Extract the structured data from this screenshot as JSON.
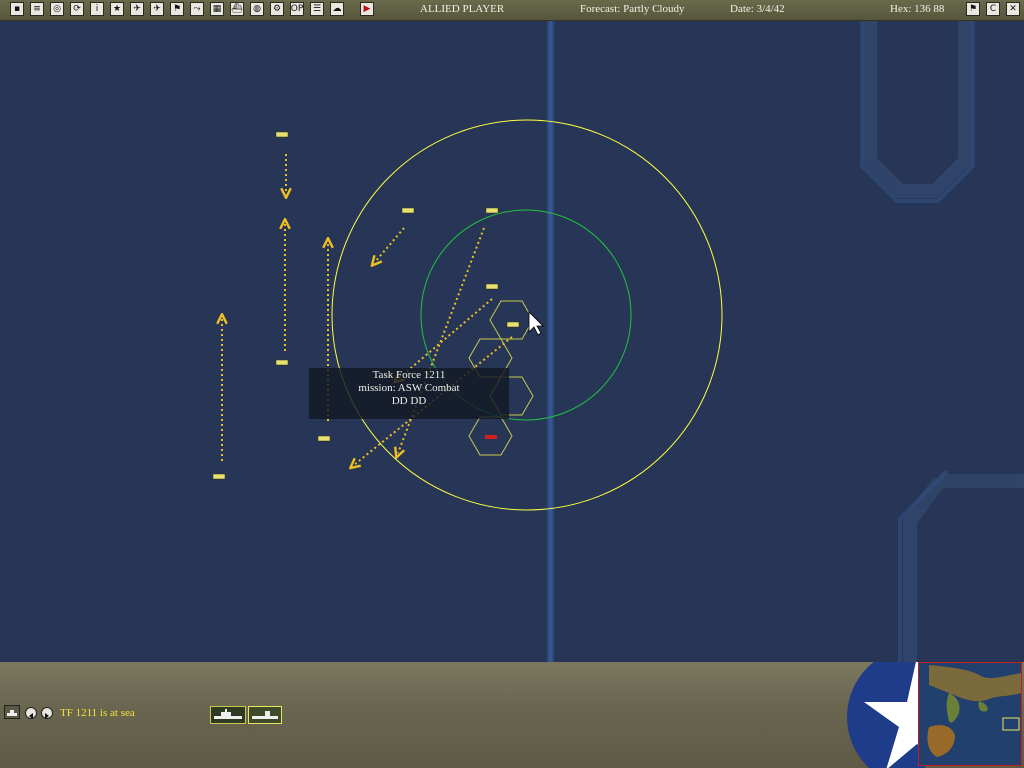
{
  "toolbar": {
    "icons": [
      {
        "name": "save-icon",
        "glyph": "▪"
      },
      {
        "name": "document-icon",
        "glyph": "≡"
      },
      {
        "name": "database-icon",
        "glyph": "◎"
      },
      {
        "name": "sync-icon",
        "glyph": "⟳"
      },
      {
        "name": "info-icon",
        "glyph": "i"
      },
      {
        "name": "medal-star-icon",
        "glyph": "★"
      },
      {
        "name": "aircraft-icon",
        "glyph": "✈"
      },
      {
        "name": "fighter-icon",
        "glyph": "✈"
      },
      {
        "name": "flag-icon",
        "glyph": "⚑"
      },
      {
        "name": "route-icon",
        "glyph": "⤳"
      },
      {
        "name": "intel-icon",
        "glyph": "▦"
      },
      {
        "name": "ship-icon",
        "glyph": "⛴"
      },
      {
        "name": "globe-icon",
        "glyph": "◍"
      },
      {
        "name": "settings-icon",
        "glyph": "⚙"
      },
      {
        "name": "op-icon",
        "glyph": "OP"
      },
      {
        "name": "list-icon",
        "glyph": "☰"
      },
      {
        "name": "weather-icon",
        "glyph": "☁"
      },
      {
        "name": "play-turn-icon",
        "glyph": "▶"
      }
    ],
    "player": "ALLIED PLAYER",
    "forecast": "Forecast: Partly Cloudy",
    "date": "Date: 3/4/42",
    "hex": "Hex: 136 88",
    "right_icons": [
      {
        "name": "flag-right-icon",
        "glyph": "⚑"
      },
      {
        "name": "c-icon",
        "glyph": "C"
      },
      {
        "name": "close-icon",
        "glyph": "✕"
      }
    ]
  },
  "tooltip": {
    "title": "Task Force 1211",
    "mission": "mission: ASW Combat",
    "ships": "DD DD"
  },
  "status_bar": {
    "message": "TF 1211 is at sea"
  },
  "colors": {
    "ocean": "#273656",
    "range_outer": "#ffff40",
    "range_inner": "#20c040",
    "hex_outline": "#c8c850",
    "move_arrow": "#f0c020",
    "status_text": "#f3e53a",
    "panel": "#6a6650"
  }
}
